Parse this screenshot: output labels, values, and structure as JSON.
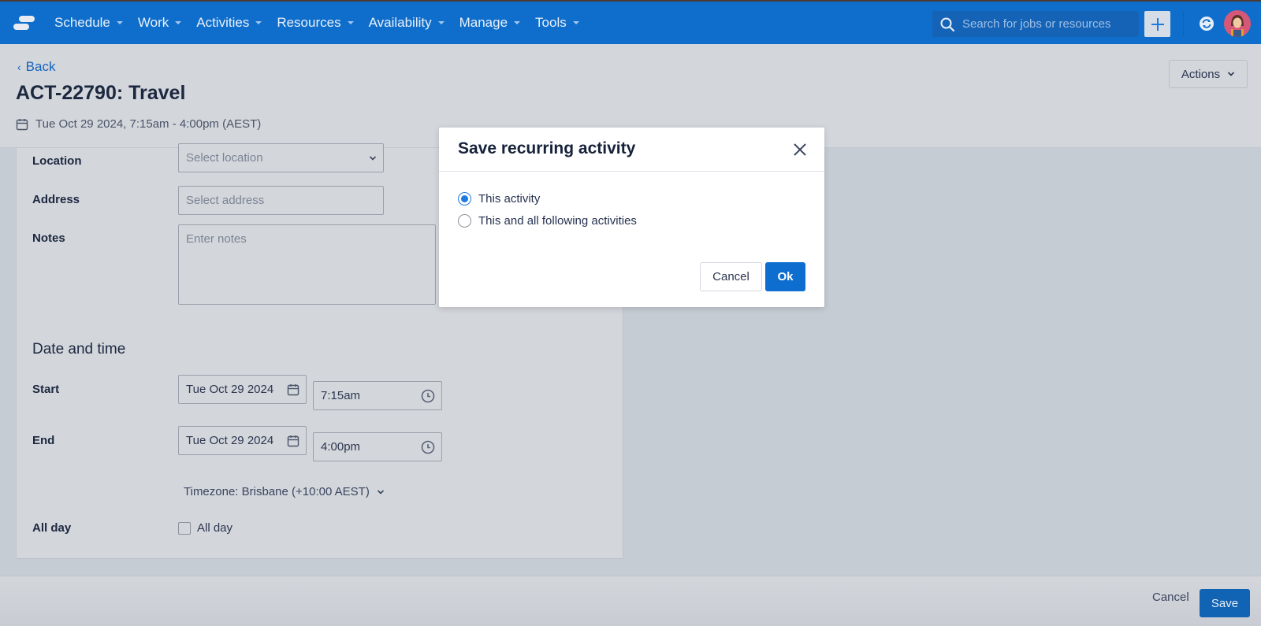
{
  "topbar": {
    "nav": [
      {
        "label": "Schedule"
      },
      {
        "label": "Work"
      },
      {
        "label": "Activities"
      },
      {
        "label": "Resources"
      },
      {
        "label": "Availability"
      },
      {
        "label": "Manage"
      },
      {
        "label": "Tools"
      }
    ],
    "search_placeholder": "Search for jobs or resources",
    "colors": {
      "bar": "#0f6ecb",
      "accent": "#1f7ae0"
    }
  },
  "header": {
    "back_label": "Back",
    "title": "ACT-22790: Travel",
    "subtitle": "Tue Oct 29 2024, 7:15am - 4:00pm (AEST)",
    "actions_label": "Actions"
  },
  "form": {
    "location": {
      "label": "Location",
      "placeholder": "Select location"
    },
    "address": {
      "label": "Address",
      "placeholder": "Select address"
    },
    "notes": {
      "label": "Notes",
      "placeholder": "Enter notes"
    },
    "date_section_title": "Date and time",
    "start": {
      "label": "Start",
      "date": "Tue Oct 29 2024",
      "time": "7:15am"
    },
    "end": {
      "label": "End",
      "date": "Tue Oct 29 2024",
      "time": "4:00pm"
    },
    "timezone": "Timezone: Brisbane (+10:00 AEST)",
    "all_day": {
      "label": "All day",
      "checkbox_label": "All day",
      "checked": false
    }
  },
  "footer": {
    "cancel_label": "Cancel",
    "save_label": "Save"
  },
  "modal": {
    "title": "Save recurring activity",
    "options": [
      {
        "label": "This activity",
        "selected": true
      },
      {
        "label": "This and all following activities",
        "selected": false
      }
    ],
    "cancel_label": "Cancel",
    "ok_label": "Ok"
  }
}
